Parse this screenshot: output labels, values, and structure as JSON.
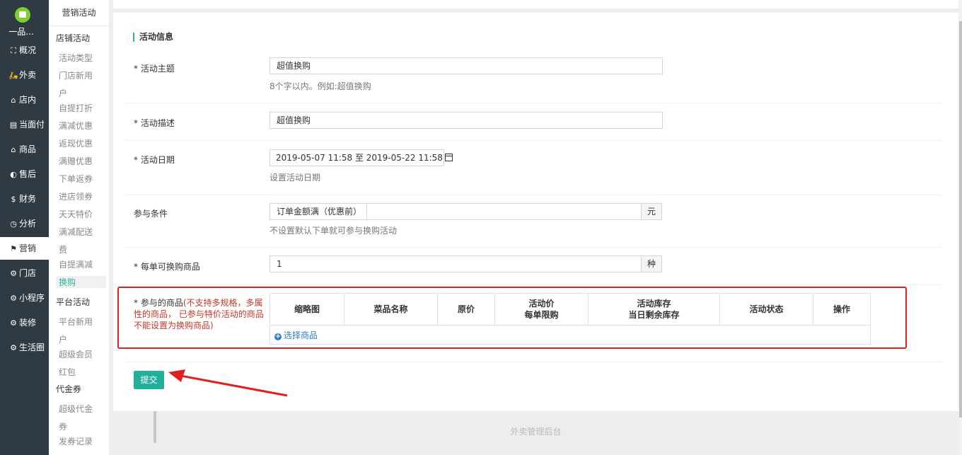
{
  "nav": {
    "shop_name": "一品...",
    "items": [
      {
        "icon": "dashboard-icon",
        "glyph": "⛶",
        "label": "概况"
      },
      {
        "icon": "scooter-icon",
        "glyph": "🛵",
        "label": "外卖"
      },
      {
        "icon": "store-icon",
        "glyph": "⌂",
        "label": "店内"
      },
      {
        "icon": "bill-icon",
        "glyph": "▤",
        "label": "当面付"
      },
      {
        "icon": "bag-icon",
        "glyph": "⌂",
        "label": "商品"
      },
      {
        "icon": "service-icon",
        "glyph": "◐",
        "label": "售后"
      },
      {
        "icon": "money-icon",
        "glyph": "$",
        "label": "财务"
      },
      {
        "icon": "chart-icon",
        "glyph": "◷",
        "label": "分析"
      },
      {
        "icon": "flag-icon",
        "glyph": "⚑",
        "label": "营销"
      },
      {
        "icon": "gear-icon",
        "glyph": "⚙",
        "label": "门店"
      },
      {
        "icon": "gear-icon",
        "glyph": "⚙",
        "label": "小程序"
      },
      {
        "icon": "gear-icon",
        "glyph": "⚙",
        "label": "装修"
      },
      {
        "icon": "gear-icon",
        "glyph": "⚙",
        "label": "生活圈"
      }
    ]
  },
  "subnav": {
    "header": "营销活动",
    "group1": "店铺活动",
    "items1": [
      "活动类型",
      "门店新用",
      "户",
      "自提打折",
      "满减优惠",
      "返现优惠",
      "满赠优惠",
      "下单返券",
      "进店领券",
      "天天特价",
      "满减配送",
      "费",
      "自提满减",
      "换购"
    ],
    "group2": "平台活动",
    "items2": [
      "平台新用",
      "户",
      "超级会员",
      "红包"
    ],
    "group3": "代金券",
    "items3": [
      "超级代金",
      "券",
      "发券记录"
    ]
  },
  "form": {
    "section_title": "活动信息",
    "theme_label": "* 活动主题",
    "theme_value": "超值换购",
    "theme_help": "8个字以内。例如:超值换购",
    "desc_label": "* 活动描述",
    "desc_value": "超值换购",
    "date_label": "* 活动日期",
    "date_value": "2019-05-07 11:58 至 2019-05-22 11:58",
    "date_help": "设置活动日期",
    "cond_label": "参与条件",
    "cond_prefix": "订单金额满（优惠前）",
    "cond_value": "",
    "cond_suffix": "元",
    "cond_help": "不设置默认下单就可参与换购活动",
    "limit_label": "* 每单可换购商品",
    "limit_value": "1",
    "limit_suffix": "种",
    "goods_label": "* 参与的商品",
    "goods_warning": "(不支持多规格，多属性的商品， 已参与特价活动的商品不能设置为换购商品)",
    "table_headers": [
      {
        "l1": "缩略图",
        "l2": ""
      },
      {
        "l1": "菜品名称",
        "l2": ""
      },
      {
        "l1": "原价",
        "l2": ""
      },
      {
        "l1": "活动价",
        "l2": "每单限购"
      },
      {
        "l1": "活动库存",
        "l2": "当日剩余库存"
      },
      {
        "l1": "活动状态",
        "l2": ""
      },
      {
        "l1": "操作",
        "l2": ""
      }
    ],
    "select_goods": "选择商品",
    "submit": "提交"
  },
  "footer": "外卖管理后台",
  "colors": {
    "accent": "#23b09a",
    "highlight": "#e02020",
    "link": "#2f7ec0",
    "nav_bg": "#2f3a43"
  }
}
